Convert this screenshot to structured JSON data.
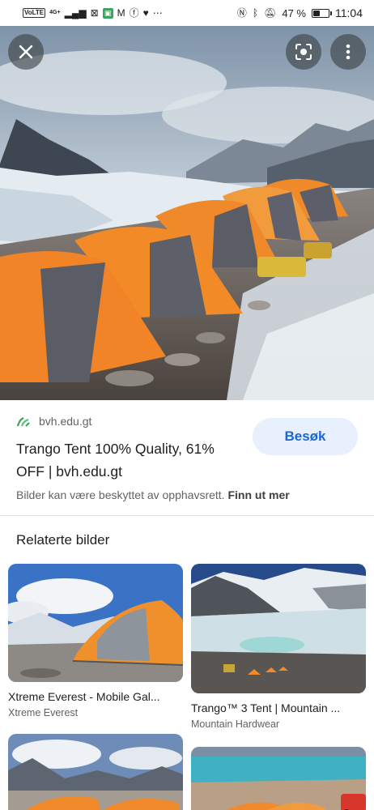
{
  "status_bar": {
    "left_badges": [
      "VoLTE",
      "4G+"
    ],
    "battery_percent": "47 %",
    "battery_level": 0.47,
    "time": "11:04"
  },
  "hero": {
    "icons": [
      "close-icon",
      "lens-icon",
      "more-vert-icon"
    ]
  },
  "result": {
    "source": "bvh.edu.gt",
    "title": "Trango Tent 100% Quality, 61% OFF | bvh.edu.gt",
    "visit_label": "Besøk",
    "copyright_text": "Bilder kan være beskyttet av opphavsrett.",
    "learn_more": "Finn ut mer"
  },
  "related": {
    "heading": "Relaterte bilder",
    "items": [
      {
        "title": "Xtreme Everest - Mobile Gal...",
        "source": "Xtreme Everest"
      },
      {
        "title": "Trango™ 3 Tent | Mountain ...",
        "source": "Mountain Hardwear"
      },
      {
        "title": "",
        "source": ""
      },
      {
        "title": "",
        "source": ""
      }
    ]
  },
  "colors": {
    "accent": "#1967d2",
    "visit_bg": "#e8f0fe",
    "tent_orange": "#f0892a"
  }
}
